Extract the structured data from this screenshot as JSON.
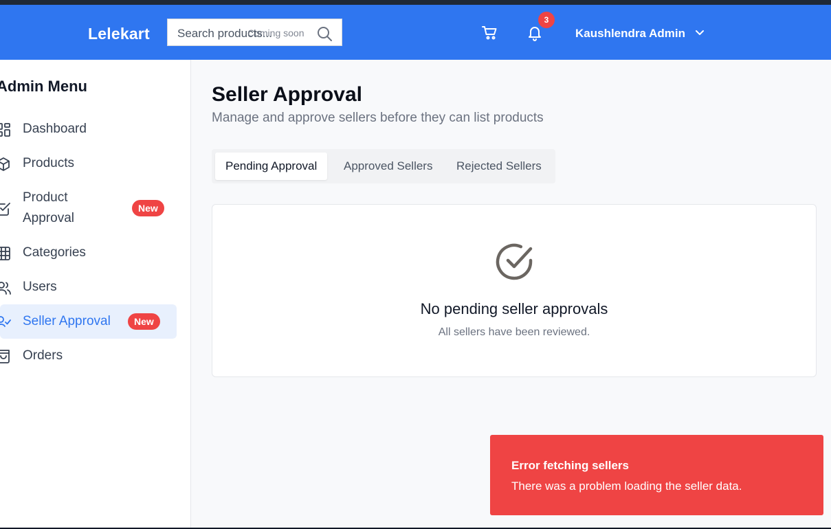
{
  "header": {
    "brand": "Lelekart",
    "search_placeholder": "Search products...",
    "search_note": "Coming soon",
    "notification_count": "3",
    "user_name": "Kaushlendra Admin",
    "accent": "#2f76f0"
  },
  "sidebar": {
    "title": "Admin Menu",
    "items": [
      {
        "label": "Dashboard",
        "icon": "dashboard-icon"
      },
      {
        "label": "Products",
        "icon": "package-icon"
      },
      {
        "label": "Product Approval",
        "icon": "checkbox-icon",
        "badge": "New"
      },
      {
        "label": "Categories",
        "icon": "grid-icon"
      },
      {
        "label": "Users",
        "icon": "users-icon"
      },
      {
        "label": "Seller Approval",
        "icon": "user-check-icon",
        "badge": "New",
        "active": true
      },
      {
        "label": "Orders",
        "icon": "bag-icon"
      }
    ]
  },
  "main": {
    "title": "Seller Approval",
    "subtitle": "Manage and approve sellers before they can list products",
    "tabs": [
      {
        "label": "Pending Approval",
        "active": true
      },
      {
        "label": "Approved Sellers"
      },
      {
        "label": "Rejected Sellers"
      }
    ],
    "empty_state": {
      "title": "No pending seller approvals",
      "description": "All sellers have been reviewed."
    }
  },
  "toast": {
    "title": "Error fetching sellers",
    "message": "There was a problem loading the seller data.",
    "color": "#ef4444"
  }
}
